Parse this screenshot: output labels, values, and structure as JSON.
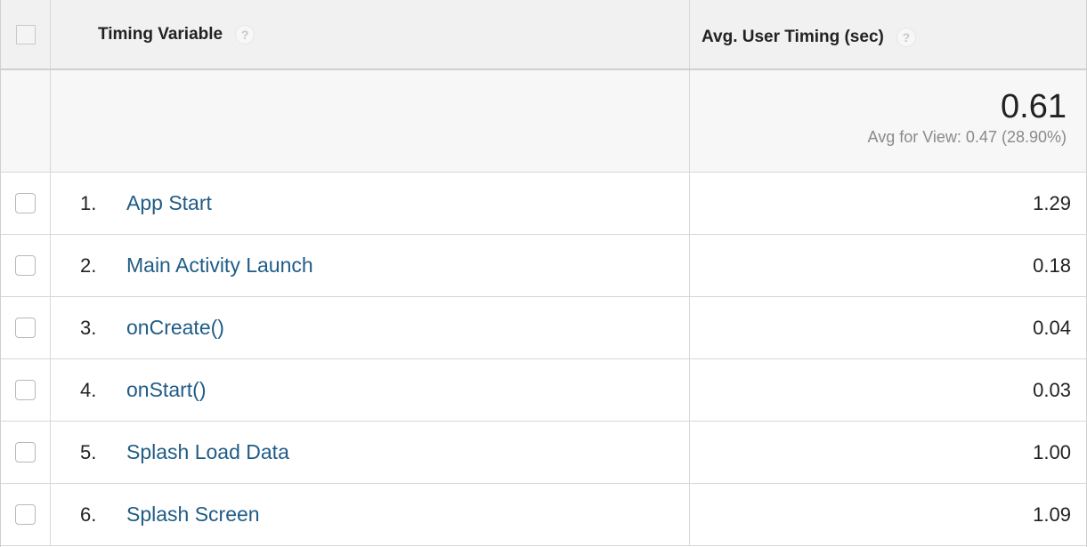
{
  "header": {
    "col_variable": "Timing Variable",
    "col_value": "Avg. User Timing (sec)",
    "help_glyph": "?"
  },
  "summary": {
    "total": "0.61",
    "avg_for_view": "Avg for View: 0.47 (28.90%)"
  },
  "rows": [
    {
      "index": "1.",
      "name": "App Start",
      "value": "1.29"
    },
    {
      "index": "2.",
      "name": "Main Activity Launch",
      "value": "0.18"
    },
    {
      "index": "3.",
      "name": "onCreate()",
      "value": "0.04"
    },
    {
      "index": "4.",
      "name": "onStart()",
      "value": "0.03"
    },
    {
      "index": "5.",
      "name": "Splash Load Data",
      "value": "1.00"
    },
    {
      "index": "6.",
      "name": "Splash Screen",
      "value": "1.09"
    }
  ],
  "colors": {
    "link": "#1f5c86",
    "header_bg": "#f1f1f1",
    "summary_bg": "#f7f7f7",
    "subtext": "#8a8a8a"
  }
}
